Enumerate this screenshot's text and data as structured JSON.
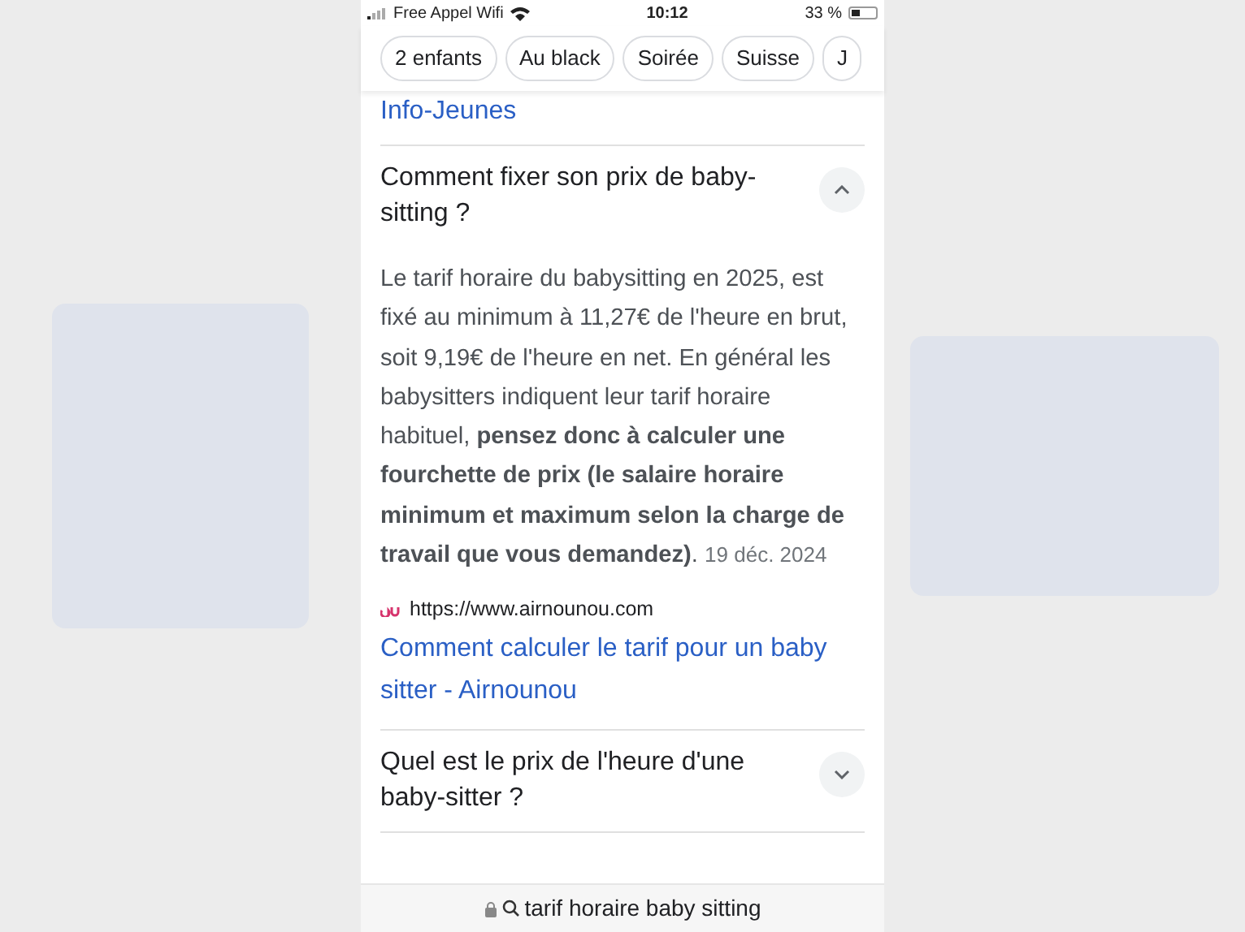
{
  "status_bar": {
    "carrier": "Free Appel Wifi",
    "time": "10:12",
    "battery": "33 %"
  },
  "chips": [
    {
      "label": "2 enfants"
    },
    {
      "label": "Au black"
    },
    {
      "label": "Soirée"
    },
    {
      "label": "Suisse"
    },
    {
      "label": "J"
    }
  ],
  "previous_link": "Info-Jeunes",
  "faq": [
    {
      "question": "Comment fixer son prix de baby-sitting ?",
      "expanded": true,
      "answer": "Le tarif horaire du babysitting en 2025, est fixé au minimum à 11,27€ de l'heure en brut, soit 9,19€ de l'heure en net. En général les babysitters indiquent leur tarif horaire habituel, **pensez donc à calculer une fourchette de prix (le salaire horaire minimum et maximum selon la charge de travail que vous demandez)**.",
      "date": "19 déc. 2024",
      "source_url": "https://www.airnounou.com",
      "source_title": "Comment calculer le tarif pour un baby sitter - Airnounou"
    },
    {
      "question": "Quel est le prix de l'heure d'une baby-sitter ?",
      "expanded": false
    }
  ],
  "address_bar": {
    "query": "tarif horaire baby sitting"
  }
}
